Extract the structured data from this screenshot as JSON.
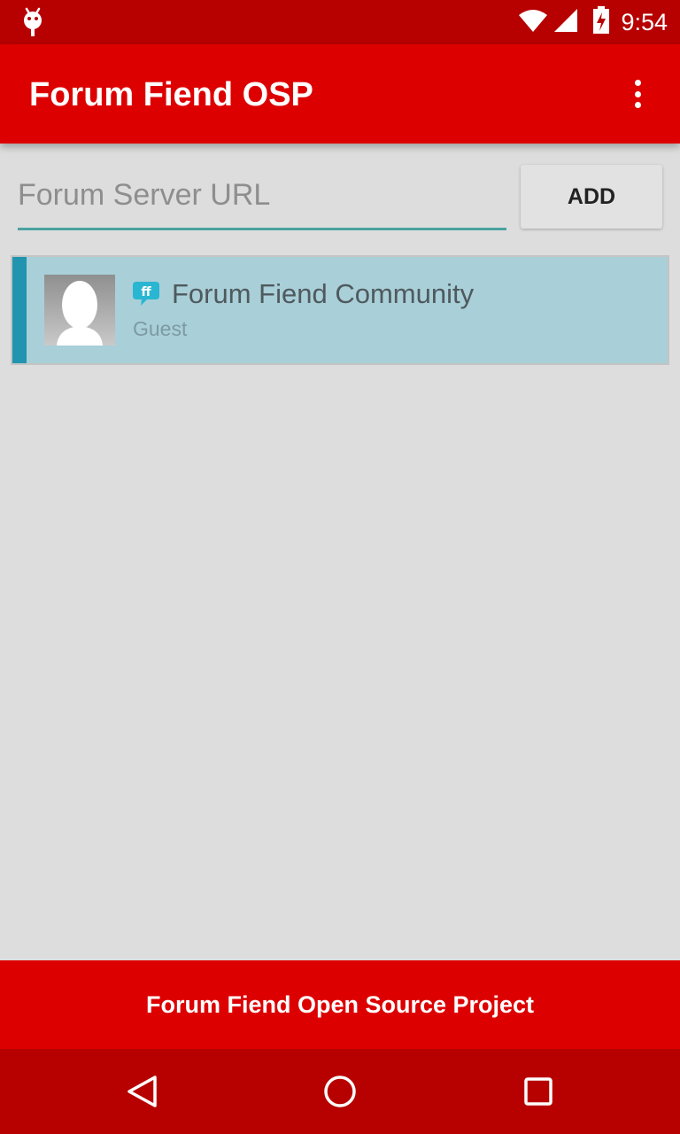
{
  "status_bar": {
    "time": "9:54",
    "icons": [
      "android-debug-icon",
      "wifi-icon",
      "cell-signal-icon",
      "battery-charging-icon"
    ]
  },
  "app_bar": {
    "title": "Forum Fiend OSP",
    "menu_icon": "overflow-menu-icon"
  },
  "add_forum": {
    "placeholder": "Forum Server URL",
    "value": "",
    "button_label": "ADD"
  },
  "forums": [
    {
      "name": "Forum Fiend Community",
      "user": "Guest",
      "icon": "forum-fiend-icon",
      "avatar": "default-avatar"
    }
  ],
  "footer": {
    "text": "Forum Fiend Open Source Project"
  },
  "nav_bar": {
    "buttons": [
      "back-icon",
      "home-icon",
      "recents-icon"
    ]
  },
  "colors": {
    "primary": "#dd0000",
    "primary_dark": "#b70000",
    "accent": "#2194b0",
    "list_item_bg": "#a9cfd8",
    "background": "#dddddd"
  }
}
